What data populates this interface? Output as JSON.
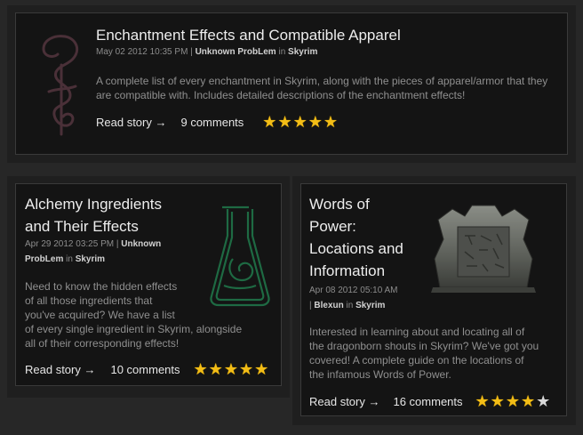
{
  "stories": [
    {
      "title": "Enchantment Effects and Compatible Apparel",
      "date": "May 02 2012 10:35 PM",
      "sep": " | ",
      "author": "Unknown ProbLem",
      "in_word": " in ",
      "category": "Skyrim",
      "description": "A complete list of every enchantment in Skyrim, along with the pieces of apparel/armor that they are compatible with. Includes detailed descriptions of the enchantment effects!",
      "read_label": "Read story →",
      "comments": "9 comments",
      "rating": 5,
      "icon": "rune-d-icon"
    },
    {
      "title_line1": "Alchemy Ingredients",
      "title_line2": "and Their Effects",
      "date": "Apr 29 2012 03:25 PM",
      "sep": " | ",
      "author_line1": "Unknown",
      "author_line2": "ProbLem",
      "in_word": " in ",
      "category": "Skyrim",
      "description_lines": [
        "Need to know the hidden effects",
        "of all those ingredients that",
        "you've acquired? We have a list",
        "of every single ingredient in Skyrim, alongside",
        "all of their corresponding effects!"
      ],
      "read_label": "Read story →",
      "comments": "10 comments",
      "rating": 5,
      "icon": "alchemy-flask-icon"
    },
    {
      "title_lines": [
        "Words of",
        "Power:",
        "Locations and",
        "Information"
      ],
      "date": "Apr 08 2012 05:10 AM",
      "sep": " | ",
      "author": "Blexun",
      "in_word": " in ",
      "category": "Skyrim",
      "description_lines": [
        "Interested in learning about and locating all of",
        "the dragonborn shouts in Skyrim? We've got you",
        "covered! A complete guide on the locations of",
        "the infamous Words of Power."
      ],
      "read_label": "Read story →",
      "comments": "16 comments",
      "rating": 4,
      "icon": "word-wall-icon"
    }
  ]
}
